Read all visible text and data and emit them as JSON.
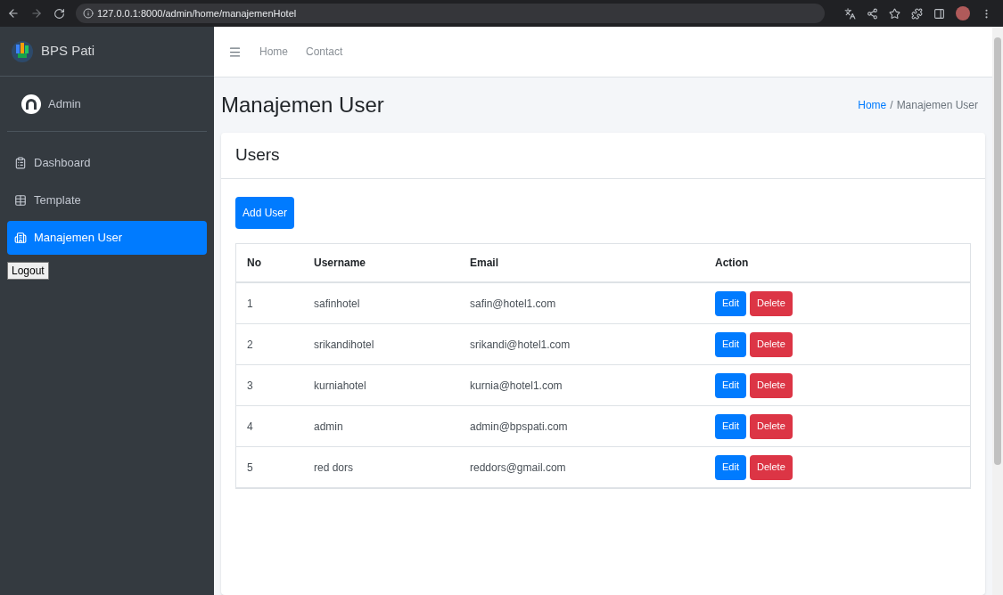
{
  "browser": {
    "url": "127.0.0.1:8000/admin/home/manajemenHotel"
  },
  "sidebar": {
    "brand": "BPS Pati",
    "user": "Admin",
    "items": [
      {
        "label": "Dashboard",
        "selected": false
      },
      {
        "label": "Template",
        "selected": false
      },
      {
        "label": "Manajemen User",
        "selected": true
      }
    ],
    "logout": "Logout"
  },
  "navbar": {
    "links": [
      "Home",
      "Contact"
    ]
  },
  "page_title": "Manajemen User",
  "breadcrumb_separator": "/",
  "breadcrumb": [
    {
      "label": "Home",
      "link": true
    },
    {
      "label": "Manajemen User",
      "link": false
    }
  ],
  "card": {
    "title": "Users",
    "add_button": "Add User",
    "table": {
      "columns": [
        "No",
        "Username",
        "Email",
        "Action"
      ],
      "rows": [
        {
          "no": "1",
          "username": "safinhotel",
          "email": "safin@hotel1.com",
          "actions": [
            "Edit",
            "Delete"
          ]
        },
        {
          "no": "2",
          "username": "srikandihotel",
          "email": "srikandi@hotel1.com",
          "actions": [
            "Edit",
            "Delete"
          ]
        },
        {
          "no": "3",
          "username": "kurniahotel",
          "email": "kurnia@hotel1.com",
          "actions": [
            "Edit",
            "Delete"
          ]
        },
        {
          "no": "4",
          "username": "admin",
          "email": "admin@bpspati.com",
          "actions": [
            "Edit",
            "Delete"
          ]
        },
        {
          "no": "5",
          "username": "red dors",
          "email": "reddors@gmail.com",
          "actions": [
            "Edit",
            "Delete"
          ]
        }
      ]
    }
  }
}
